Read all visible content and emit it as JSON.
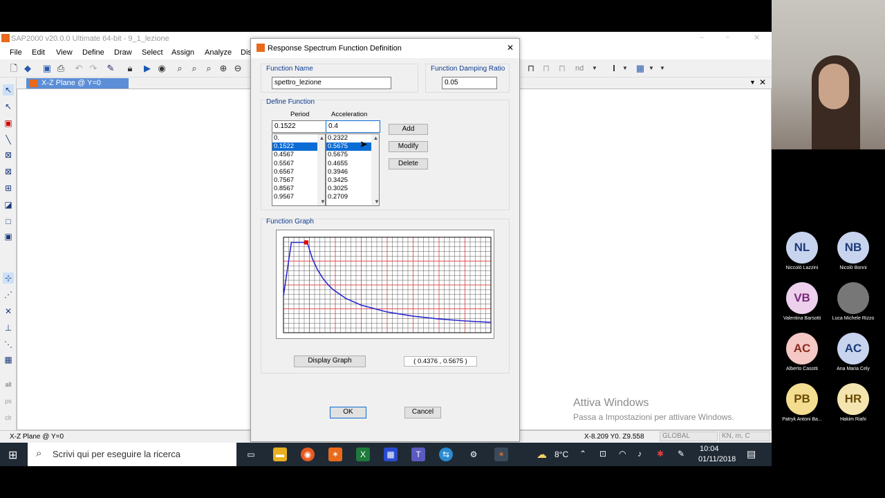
{
  "app": {
    "title": "SAP2000 v20.0.0 Ultimate 64-bit - 9_1_lezione",
    "menu": [
      "File",
      "Edit",
      "View",
      "Define",
      "Draw",
      "Select",
      "Assign",
      "Analyze",
      "Dis"
    ],
    "view_tab": "X-Z Plane @ Y=0",
    "status_left": "X-Z Plane @ Y=0",
    "status_coords": "X-8.209  Y0.  Z9.558",
    "status_coord_sys": "GLOBAL",
    "status_units": "KN, m, C",
    "toolbar_text_nd": "nd"
  },
  "dialog": {
    "title": "Response Spectrum  Function Definition",
    "function_name_label": "Function Name",
    "function_name_value": "spettro_lezione",
    "damping_label": "Function Damping Ratio",
    "damping_value": "0.05",
    "define_label": "Define Function",
    "period_header": "Period",
    "accel_header": "Acceleration",
    "period_input": "0.1522",
    "accel_input": "0.4",
    "periods": [
      "0.",
      "0.1522",
      "0.4567",
      "0.5567",
      "0.6567",
      "0.7567",
      "0.8567",
      "0.9567"
    ],
    "accels": [
      "0.2322",
      "0.5675",
      "0.5675",
      "0.4655",
      "0.3946",
      "0.3425",
      "0.3025",
      "0.2709"
    ],
    "selected_index": 1,
    "add_label": "Add",
    "modify_label": "Modify",
    "delete_label": "Delete",
    "graph_label": "Function Graph",
    "display_graph_label": "Display Graph",
    "coord_readout": "( 0.4376  ,  0.5675 )",
    "ok_label": "OK",
    "cancel_label": "Cancel"
  },
  "chart_data": {
    "type": "line",
    "x": [
      0,
      0.1522,
      0.4567,
      0.5567,
      0.6567,
      0.7567,
      0.8567,
      0.9567,
      1.2,
      1.5,
      2.0,
      2.5,
      3.0,
      3.5,
      4.0
    ],
    "y": [
      0.2322,
      0.5675,
      0.5675,
      0.4655,
      0.3946,
      0.3425,
      0.3025,
      0.2709,
      0.216,
      0.173,
      0.13,
      0.104,
      0.086,
      0.074,
      0.065
    ],
    "highlight": [
      0.4376,
      0.5675
    ],
    "xlim": [
      0,
      4.0
    ],
    "ylim": [
      0,
      0.6
    ],
    "grid": true,
    "line_color": "#2a2ad0",
    "grid_color_major": "#e05050",
    "grid_color_minor": "#555555"
  },
  "watermark": {
    "title": "Attiva Windows",
    "subtitle": "Passa a Impostazioni per attivare Windows."
  },
  "taskbar": {
    "search_placeholder": "Scrivi qui per eseguire la ricerca",
    "temperature": "8°C",
    "time": "10:04",
    "date": "01/11/2018"
  },
  "participants": [
    {
      "initials": "NL",
      "name": "Niccolò Lazzini",
      "color": "#c8d4ee",
      "text": "#1b3a7a"
    },
    {
      "initials": "NB",
      "name": "Nicolò Bonni",
      "color": "#c8d4ee",
      "text": "#1b3a7a"
    },
    {
      "initials": "VB",
      "name": "Valentina Barsotti",
      "color": "#ecd0ec",
      "text": "#7a2a7a"
    },
    {
      "initials": "",
      "name": "Luca Michele Rizzo",
      "color": "#777777",
      "text": "#ffffff"
    },
    {
      "initials": "AC",
      "name": "Alberto Casotti",
      "color": "#f4c8c4",
      "text": "#8a2a20"
    },
    {
      "initials": "AC",
      "name": "Ana Maria Cely",
      "color": "#c8d4ee",
      "text": "#1b3a7a"
    },
    {
      "initials": "PB",
      "name": "Patryk Antoni Ba...",
      "color": "#f4dc90",
      "text": "#6a4a00"
    },
    {
      "initials": "HR",
      "name": "Hakim Riahi",
      "color": "#f4e4b0",
      "text": "#6a4a00"
    }
  ]
}
